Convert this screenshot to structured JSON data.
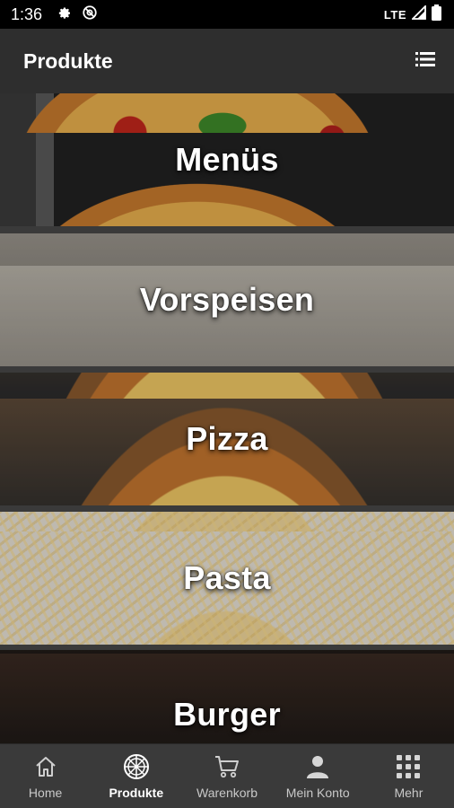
{
  "status_bar": {
    "time": "1:36",
    "network": "LTE",
    "icons": [
      "gear-icon",
      "at-icon",
      "signal-icon",
      "battery-icon"
    ]
  },
  "app_bar": {
    "title": "Produkte",
    "action_icon": "list-icon"
  },
  "categories": [
    {
      "label": "Menüs"
    },
    {
      "label": "Vorspeisen"
    },
    {
      "label": "Pizza"
    },
    {
      "label": "Pasta"
    },
    {
      "label": "Burger"
    }
  ],
  "bottom_nav": {
    "items": [
      {
        "label": "Home",
        "icon": "home-icon"
      },
      {
        "label": "Produkte",
        "icon": "pizza-icon",
        "active": true
      },
      {
        "label": "Warenkorb",
        "icon": "cart-icon"
      },
      {
        "label": "Mein Konto",
        "icon": "person-icon"
      },
      {
        "label": "Mehr",
        "icon": "grid-icon"
      }
    ]
  },
  "colors": {
    "app_bar": "#2e2e2e",
    "bottom_nav": "#3a3a3a",
    "nav_inactive_text": "#c9c9c9",
    "nav_active_text": "#ffffff"
  }
}
